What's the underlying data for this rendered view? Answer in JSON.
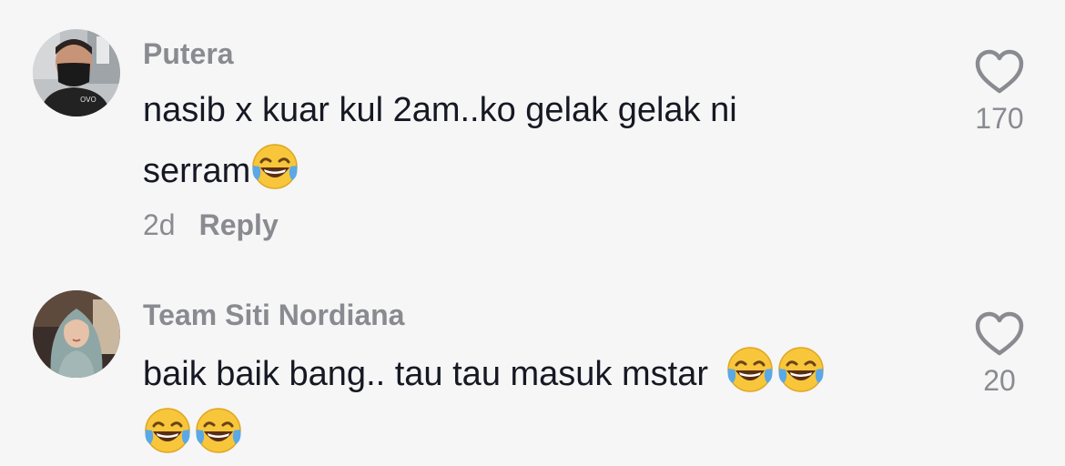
{
  "comments": [
    {
      "author": "Putera",
      "text_line1": "nasib x kuar kul 2am..ko gelak gelak ni",
      "text_line2": "serram",
      "time": "2d",
      "reply_label": "Reply",
      "likes": "170",
      "avatar_icon": "avatar-man-mask",
      "emoji": [
        "face-with-tears-of-joy"
      ]
    },
    {
      "author": "Team Siti Nordiana",
      "text_line1": "baik baik bang.. tau tau masuk mstar",
      "likes": "20",
      "avatar_icon": "avatar-woman-hijab",
      "emoji": [
        "face-with-tears-of-joy",
        "face-with-tears-of-joy",
        "face-with-tears-of-joy",
        "face-with-tears-of-joy"
      ]
    }
  ],
  "colors": {
    "background": "#f6f6f6",
    "primary_text": "#161823",
    "secondary_text": "#8a8b91"
  }
}
